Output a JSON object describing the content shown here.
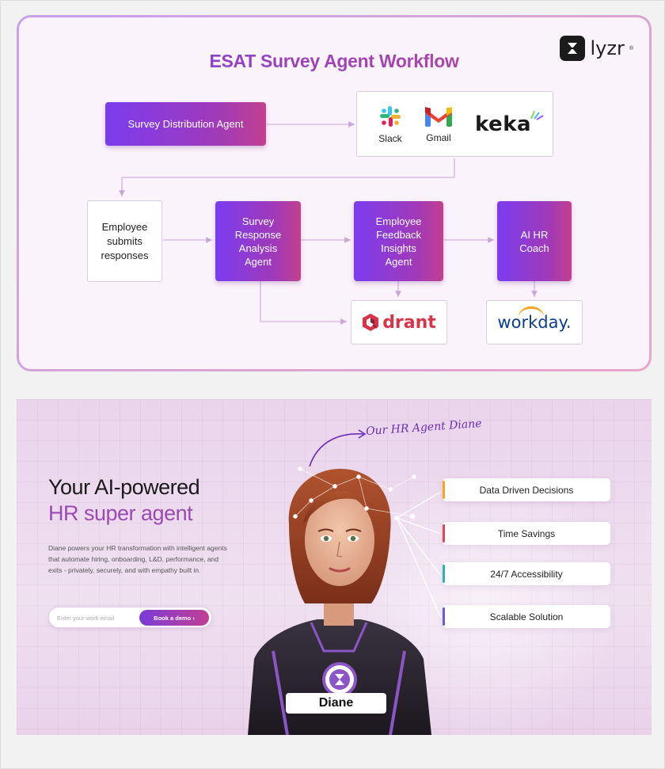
{
  "workflow": {
    "title": "ESAT Survey Agent Workflow",
    "logo_text": "lyzr",
    "distribution_agent": "Survey Distribution Agent",
    "tools": [
      {
        "label": "Slack",
        "icon": "slack-icon"
      },
      {
        "label": "Gmail",
        "icon": "gmail-icon"
      }
    ],
    "keka_logo": "keka",
    "employee_box": [
      "Employee",
      "submits",
      "responses"
    ],
    "analysis_agent": [
      "Survey",
      "Response",
      "Analysis",
      "Agent"
    ],
    "insights_agent": [
      "Employee",
      "Feedback",
      "Insights",
      "Agent"
    ],
    "coach_agent": [
      "AI HR",
      "Coach"
    ],
    "qdrant_logo": "drant",
    "workday_logo": "workday."
  },
  "hero": {
    "tagline": "Our HR Agent Diane",
    "title_line1": "Your AI-powered",
    "title_line2": "HR super agent",
    "description": "Diane powers your HR transformation with intelligent agents that automate hiring, onboarding, L&D, performance, and exits - privately, securely, and with empathy built in.",
    "email_placeholder": "Enter your work email",
    "cta_label": "Book a demo ›",
    "agent_name": "Diane",
    "features": [
      {
        "label": "Data Driven Decisions",
        "accent": "#f5a623"
      },
      {
        "label": "Time Savings",
        "accent": "#e0455a"
      },
      {
        "label": "24/7 Accessibility",
        "accent": "#2bb3b1"
      },
      {
        "label": "Scalable Solution",
        "accent": "#6a5ae0"
      }
    ]
  },
  "colors": {
    "agent_gradient_start": "#7b3cf0",
    "agent_gradient_end": "#c2408f",
    "title_purple": "#7a3fe0",
    "hero_accent": "#9a4ab2"
  }
}
